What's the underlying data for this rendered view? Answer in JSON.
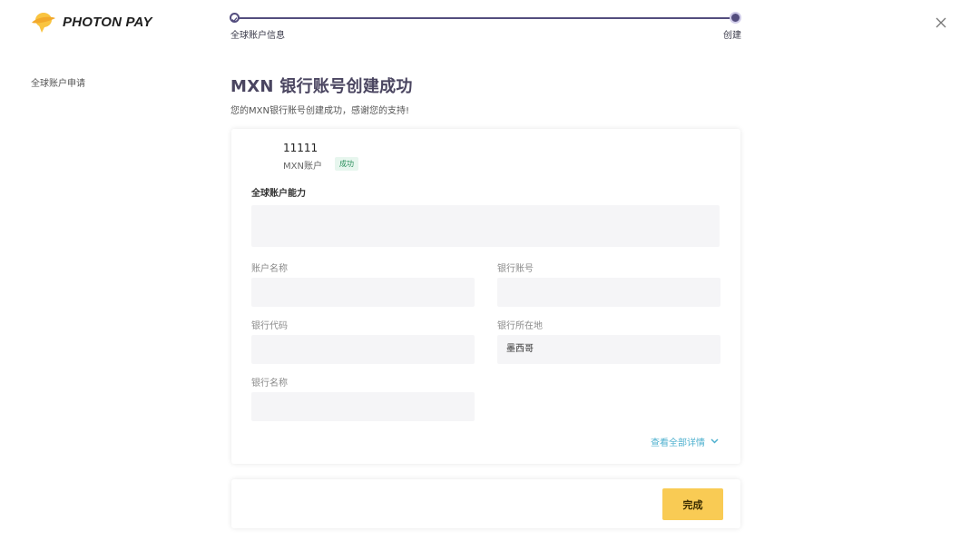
{
  "brand": {
    "name": "PHOTON PAY"
  },
  "stepper": {
    "steps": [
      {
        "label": "全球账户信息",
        "state": "done"
      },
      {
        "label": "创建",
        "state": "current"
      }
    ]
  },
  "sidebar": {
    "items": [
      {
        "label": "全球账户申请"
      }
    ]
  },
  "main": {
    "title": "MXN 银行账号创建成功",
    "subtitle": "您的MXN银行账号创建成功，感谢您的支持!"
  },
  "account": {
    "name": "11111",
    "type": "MXN账户",
    "status": "成功"
  },
  "capabilities": {
    "title": "全球账户能力",
    "value": ""
  },
  "fields": [
    {
      "label": "账户名称",
      "value": ""
    },
    {
      "label": "银行账号",
      "value": ""
    },
    {
      "label": "银行代码",
      "value": ""
    },
    {
      "label": "银行所在地",
      "value": "墨西哥"
    },
    {
      "label": "银行名称",
      "value": ""
    }
  ],
  "view_all": {
    "label": "查看全部详情"
  },
  "footer": {
    "done_label": "完成"
  },
  "icons": {
    "logo": "photon-logo-icon",
    "close": "close-icon",
    "check": "check-icon",
    "chevron": "chevron-down-icon"
  },
  "colors": {
    "primary": "#534d7e",
    "accent": "#f9cb54",
    "link": "#4fb1cf",
    "success": "#2a8f5b"
  }
}
